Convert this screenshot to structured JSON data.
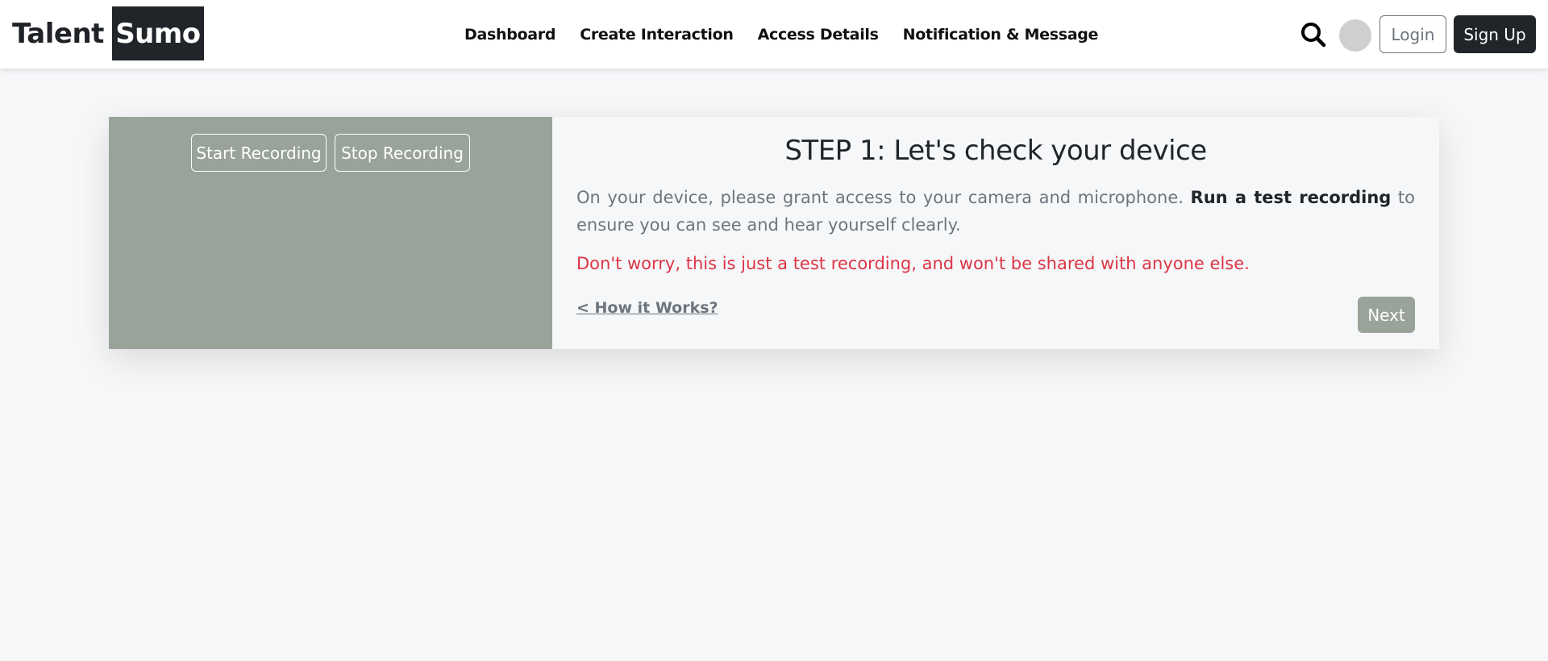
{
  "header": {
    "logo_part1": "Talent",
    "logo_part2": "Sumo",
    "nav": [
      "Dashboard",
      "Create Interaction",
      "Access Details",
      "Notification & Message"
    ],
    "login_label": "Login",
    "signup_label": "Sign Up",
    "icons": {
      "search": "search-icon",
      "avatar": "avatar"
    }
  },
  "recorder": {
    "start_label": "Start Recording",
    "stop_label": "Stop Recording"
  },
  "step": {
    "title": "STEP 1: Let's check your device",
    "desc_before": "On your device, please grant access to your camera and microphone. ",
    "desc_bold": "Run a test recording",
    "desc_after": " to ensure you can see and hear yourself clearly.",
    "warning": "Don't worry, this is just a test recording, and won't be shared with anyone else.",
    "how_link": "< How it Works?",
    "next_label": "Next"
  },
  "colors": {
    "panel": "#99a39a",
    "dark": "#212529",
    "danger": "#dc3545",
    "muted": "#6c757d"
  }
}
